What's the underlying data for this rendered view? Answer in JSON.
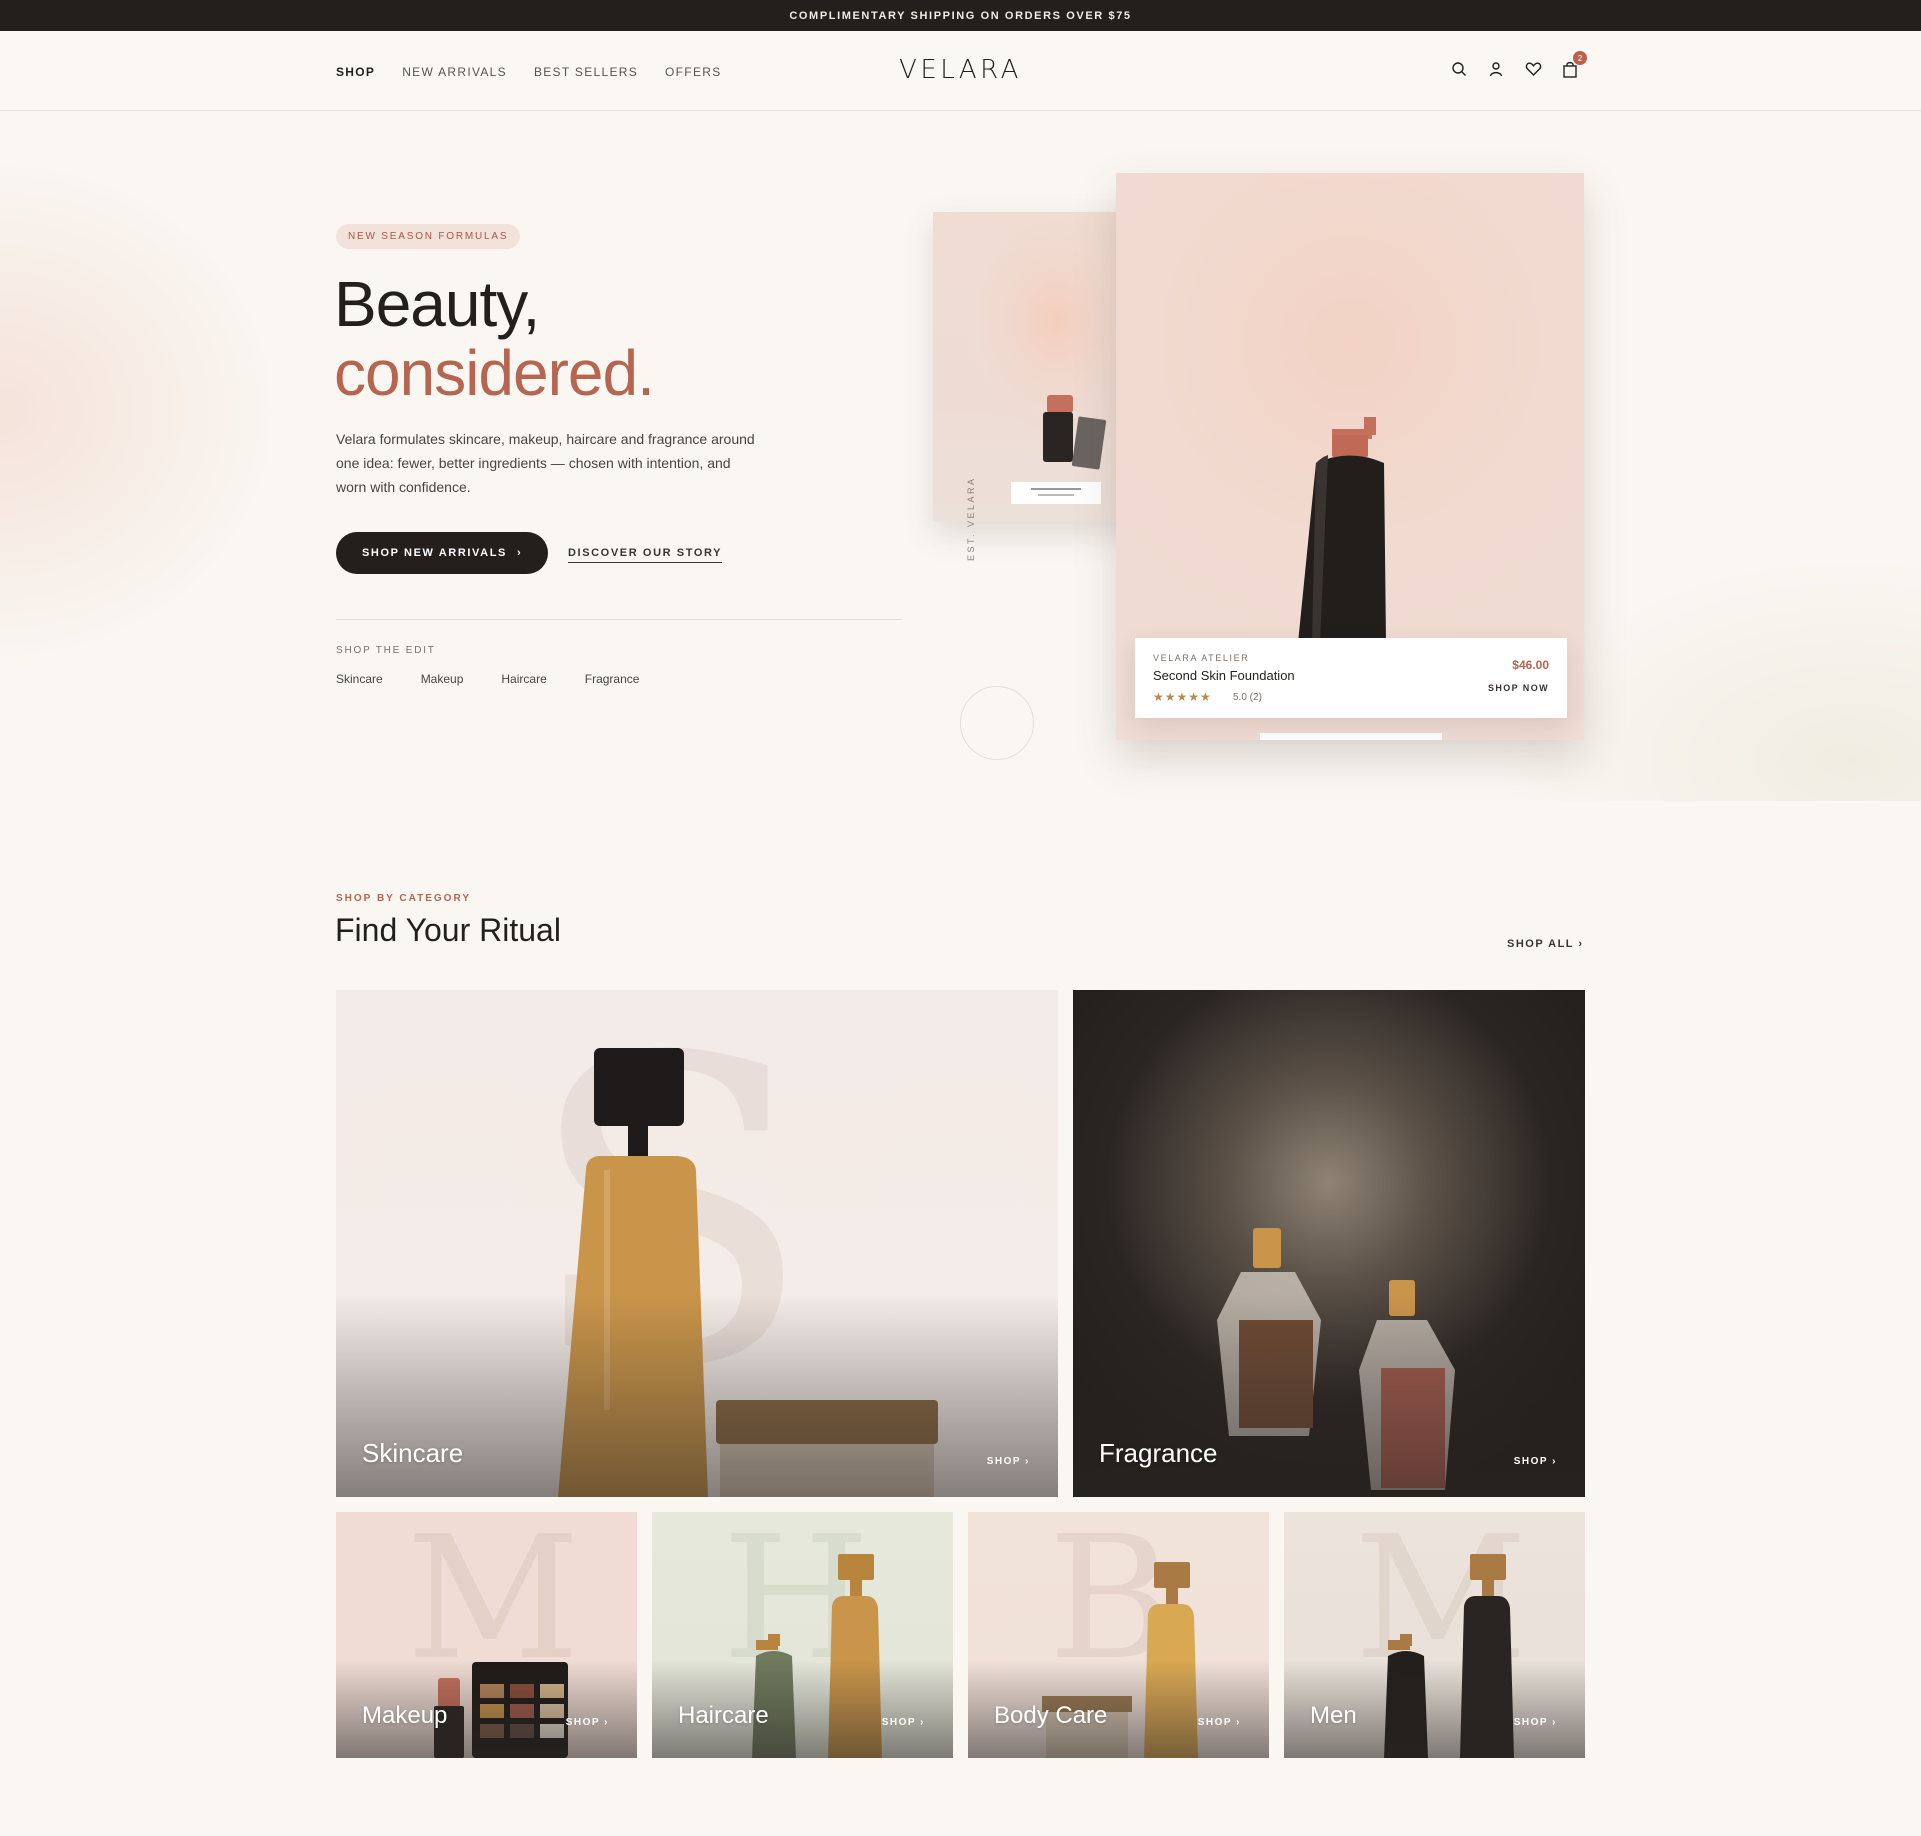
{
  "announcement": "COMPLIMENTARY SHIPPING ON ORDERS OVER $75",
  "header": {
    "logo": "VELARA",
    "nav": [
      "SHOP",
      "NEW ARRIVALS",
      "BEST SELLERS",
      "OFFERS"
    ],
    "cart_count": "2",
    "icons": [
      "search-icon",
      "account-icon",
      "wishlist-heart-icon",
      "cart-bag-icon"
    ]
  },
  "hero": {
    "eyebrow": "NEW SEASON FORMULAS",
    "title_line1": "Beauty,",
    "title_line2": "considered.",
    "body": "Velara formulates skincare, makeup, haircare and fragrance around one idea: fewer, better ingredients — chosen with intention, and worn with confidence.",
    "primary_cta": "SHOP NEW ARRIVALS",
    "secondary_cta": "DISCOVER OUR STORY",
    "edit_label": "SHOP THE EDIT",
    "edit_links": [
      "Skincare",
      "Makeup",
      "Haircare",
      "Fragrance"
    ],
    "vertical_text": "EST. VELARA",
    "product": {
      "brand": "VELARA ATELIER",
      "name": "Second Skin Foundation",
      "price": "$46.00",
      "rating": "5.0 (2)",
      "stars": "★★★★★",
      "cta": "SHOP NOW"
    }
  },
  "categories": {
    "eyebrow": "SHOP BY CATEGORY",
    "title": "Find Your Ritual",
    "shop_all": "SHOP ALL",
    "shop_label": "SHOP",
    "tiles": [
      "Skincare",
      "Fragrance",
      "Makeup",
      "Haircare",
      "Body Care",
      "Men"
    ],
    "letters": [
      "S",
      "M",
      "H",
      "B",
      "M"
    ]
  },
  "colors": {
    "accent": "#b56550",
    "dark": "#231f1d",
    "background": "#faf7f2"
  }
}
